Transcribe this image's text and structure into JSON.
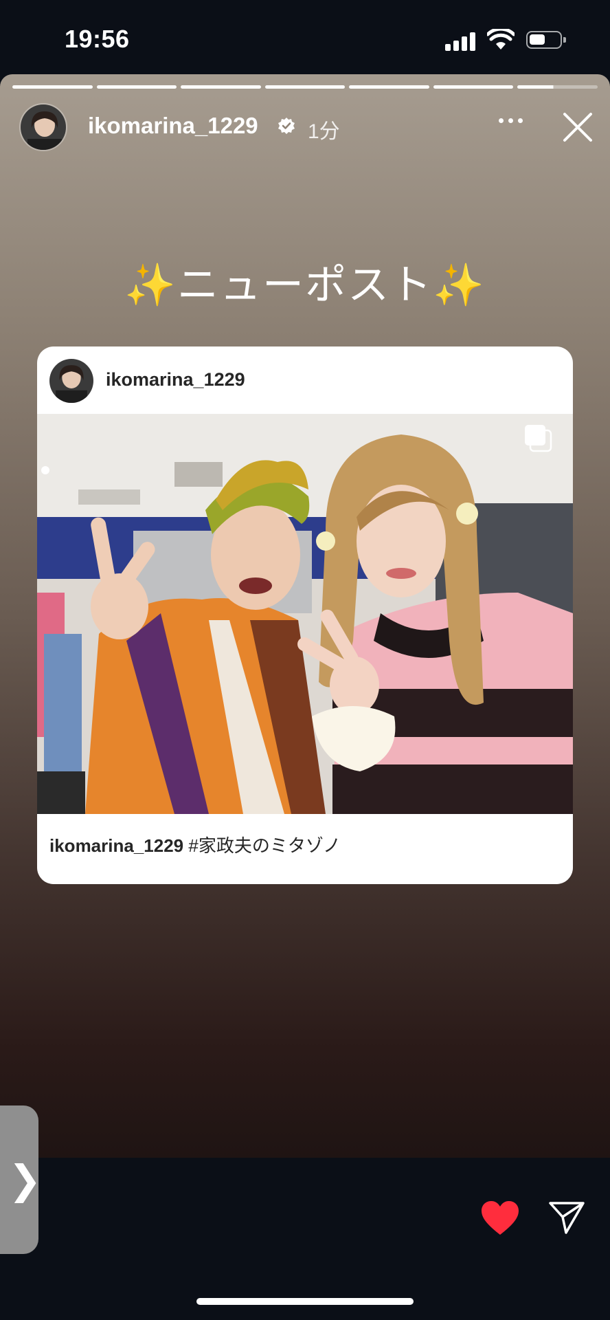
{
  "status": {
    "time": "19:56"
  },
  "story": {
    "username": "ikomarina_1229",
    "time_ago": "1分",
    "headline": "ニューポスト",
    "sparkle": "✨",
    "progress": {
      "segments": 7,
      "completed": 6,
      "current_fraction": 0.45
    }
  },
  "post": {
    "username": "ikomarina_1229",
    "caption_user": "ikomarina_1229",
    "caption_text": "#家政夫のミタゾノ"
  },
  "icons": {
    "side_tab": "chevron-right-icon",
    "like": "heart-icon",
    "share": "send-icon",
    "more": "more-icon",
    "close": "close-icon",
    "verified": "verified-badge-icon",
    "carousel": "multiple-images-icon"
  },
  "colors": {
    "heart": "#ff2d3d",
    "verified": "#ffffff",
    "background": "#0b0f17"
  }
}
